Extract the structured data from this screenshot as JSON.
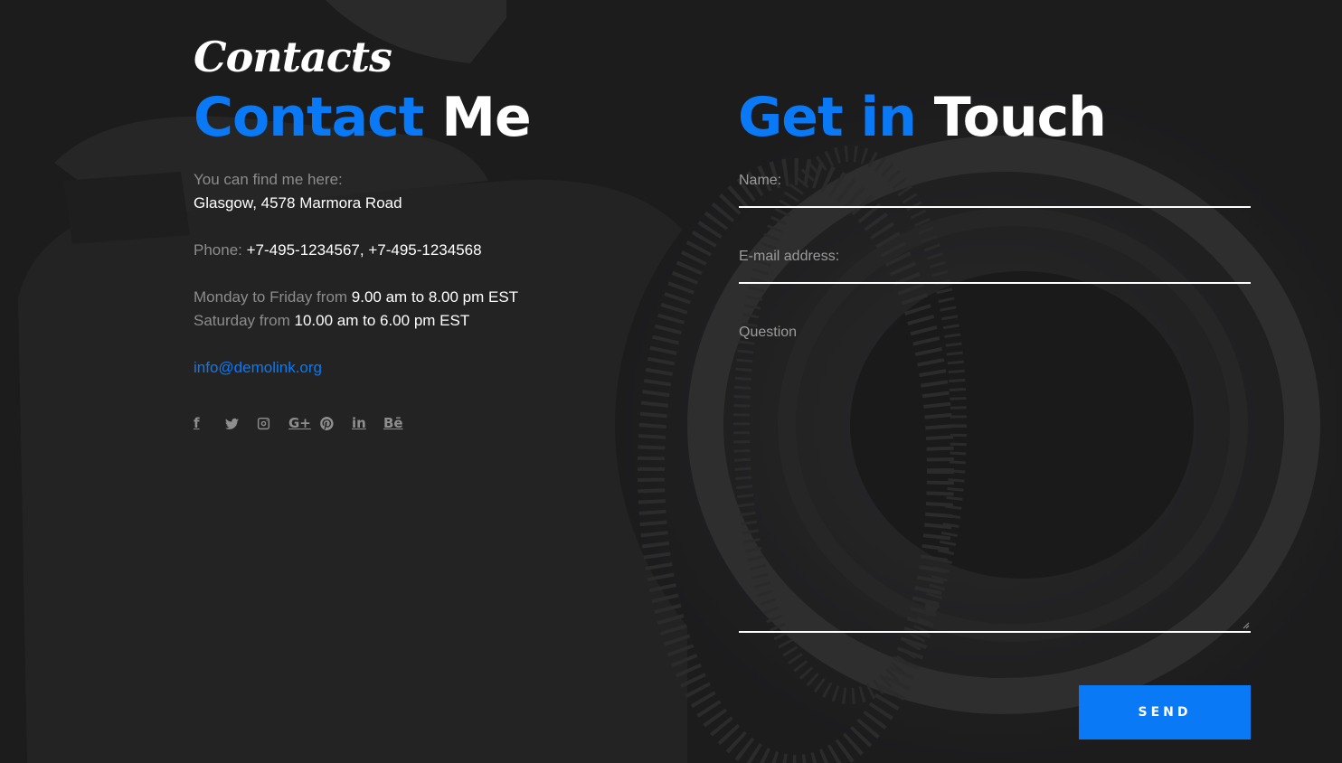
{
  "section": {
    "script_title": "Contacts"
  },
  "contact": {
    "heading_accent": "Contact",
    "heading_rest": "Me",
    "find_label": "You can find me here:",
    "address": "Glasgow, 4578 Marmora Road",
    "phone_label": "Phone:",
    "phones": "+7-495-1234567, +7-495-1234568",
    "weekday_label": "Monday to Friday from",
    "weekday_hours": "9.00 am to 8.00 pm EST",
    "saturday_label": "Saturday from",
    "saturday_hours": "10.00 am to 6.00 pm EST",
    "email": "info@demolink.org"
  },
  "socials": [
    {
      "icon": "facebook-icon",
      "glyph": "f"
    },
    {
      "icon": "twitter-icon",
      "glyph": ""
    },
    {
      "icon": "instagram-icon",
      "glyph": ""
    },
    {
      "icon": "google-plus-icon",
      "glyph": "G+"
    },
    {
      "icon": "pinterest-icon",
      "glyph": ""
    },
    {
      "icon": "linkedin-icon",
      "glyph": "in"
    },
    {
      "icon": "behance-icon",
      "glyph": "Bē"
    }
  ],
  "form": {
    "heading_accent": "Get in",
    "heading_rest": "Touch",
    "name_placeholder": "Name:",
    "email_placeholder": "E-mail address:",
    "question_placeholder": "Question",
    "send_label": "SEND"
  },
  "colors": {
    "accent": "#0a79f6",
    "background": "#1c1c1d",
    "text_muted": "#8c8c8c",
    "text_bright": "#ffffff"
  }
}
